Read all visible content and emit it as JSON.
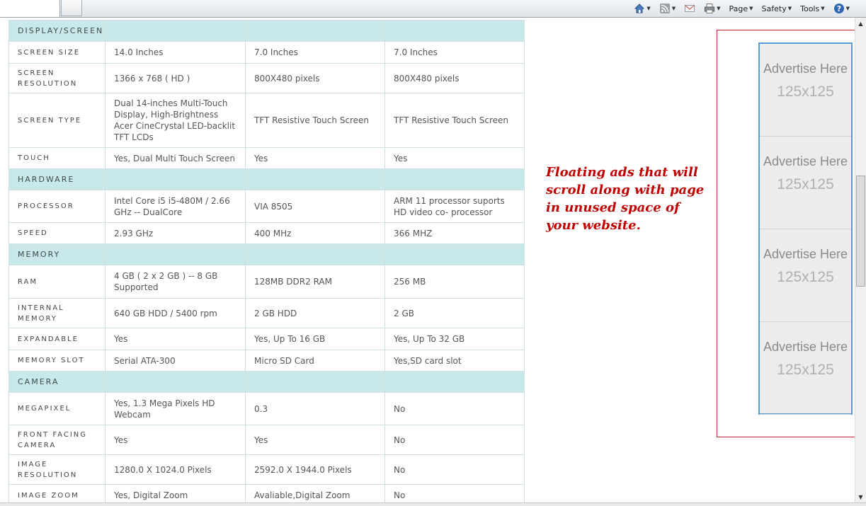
{
  "toolbar": {
    "items": [
      {
        "label": "",
        "icon": "home-icon"
      },
      {
        "label": "",
        "icon": "rss-feed-icon"
      },
      {
        "label": "",
        "icon": "read-mail-icon"
      },
      {
        "label": "",
        "icon": "print-icon"
      },
      {
        "label": "Page",
        "icon": ""
      },
      {
        "label": "Safety",
        "icon": ""
      },
      {
        "label": "Tools",
        "icon": ""
      },
      {
        "label": "",
        "icon": "help-icon"
      }
    ]
  },
  "spec_table": {
    "rows": [
      {
        "type": "section",
        "label": "DISPLAY/SCREEN",
        "cols": [
          "",
          "",
          ""
        ]
      },
      {
        "type": "row",
        "label": "SCREEN SIZE",
        "cols": [
          "14.0 Inches",
          "7.0 Inches",
          "7.0 Inches"
        ],
        "h": 31
      },
      {
        "type": "row",
        "label": "SCREEN RESOLUTION",
        "cols": [
          "1366 x 768 ( HD )",
          "800X480 pixels",
          "800X480 pixels"
        ],
        "h": 42
      },
      {
        "type": "row",
        "label": "SCREEN TYPE",
        "cols": [
          "Dual 14-inches Multi-Touch Display, High-Brightness Acer CineCrystal LED-backlit TFT LCDs",
          "TFT Resistive Touch Screen",
          "TFT Resistive Touch Screen"
        ],
        "h": 77
      },
      {
        "type": "row",
        "label": "TOUCH",
        "cols": [
          "Yes, Dual Multi Touch Screen",
          "Yes",
          "Yes"
        ],
        "h": 30
      },
      {
        "type": "section",
        "label": "HARDWARE",
        "cols": [
          "",
          "",
          ""
        ]
      },
      {
        "type": "row",
        "label": "PROCESSOR",
        "cols": [
          "Intel Core i5 i5-480M / 2.66 GHz  -- DualCore",
          "VIA 8505",
          " ARM 11 processor suports HD video co- processor"
        ],
        "h": 46
      },
      {
        "type": "row",
        "label": "SPEED",
        "cols": [
          "2.93 GHz",
          "400 MHz",
          "366 MHZ"
        ],
        "h": 30
      },
      {
        "type": "section",
        "label": "MEMORY",
        "cols": [
          "",
          "",
          ""
        ]
      },
      {
        "type": "row",
        "label": "RAM",
        "cols": [
          "4 GB ( 2 x 2 GB )  -- 8 GB Supported",
          "128MB DDR2 RAM",
          "256 MB"
        ],
        "h": 47
      },
      {
        "type": "row",
        "label": "INTERNAL MEMORY",
        "cols": [
          "640 GB HDD / 5400 rpm",
          "2 GB HDD",
          "2 GB"
        ],
        "h": 42
      },
      {
        "type": "row",
        "label": "EXPANDABLE",
        "cols": [
          "Yes",
          "Yes, Up To 16 GB",
          "Yes, Up To 32 GB"
        ],
        "h": 31
      },
      {
        "type": "row",
        "label": "MEMORY SLOT",
        "cols": [
          "Serial ATA-300",
          "Micro SD Card",
          "Yes,SD card slot"
        ],
        "h": 30
      },
      {
        "type": "section",
        "label": "CAMERA",
        "cols": [
          "",
          "",
          ""
        ]
      },
      {
        "type": "row",
        "label": "MEGAPIXEL",
        "cols": [
          "Yes, 1.3 Mega Pixels HD Webcam",
          "0.3",
          "No"
        ],
        "h": 46
      },
      {
        "type": "row",
        "label": "FRONT FACING CAMERA",
        "cols": [
          "Yes",
          "Yes",
          "No"
        ],
        "h": 42
      },
      {
        "type": "row",
        "label": "IMAGE RESOLUTION",
        "cols": [
          "1280.0 X 1024.0 Pixels",
          "2592.0 X 1944.0 Pixels",
          "No"
        ],
        "h": 42
      },
      {
        "type": "row",
        "label": "IMAGE ZOOM",
        "cols": [
          "Yes, Digital Zoom",
          "Avaliable,Digital Zoom",
          "No"
        ],
        "h": 31
      }
    ]
  },
  "floating_text": "Floating ads that will scroll along with page in unused space of your website.",
  "ads": [
    {
      "title": "Advertise Here",
      "size": "125x125"
    },
    {
      "title": "Advertise Here",
      "size": "125x125"
    },
    {
      "title": "Advertise Here",
      "size": "125x125"
    },
    {
      "title": "Advertise Here",
      "size": "125x125"
    }
  ]
}
